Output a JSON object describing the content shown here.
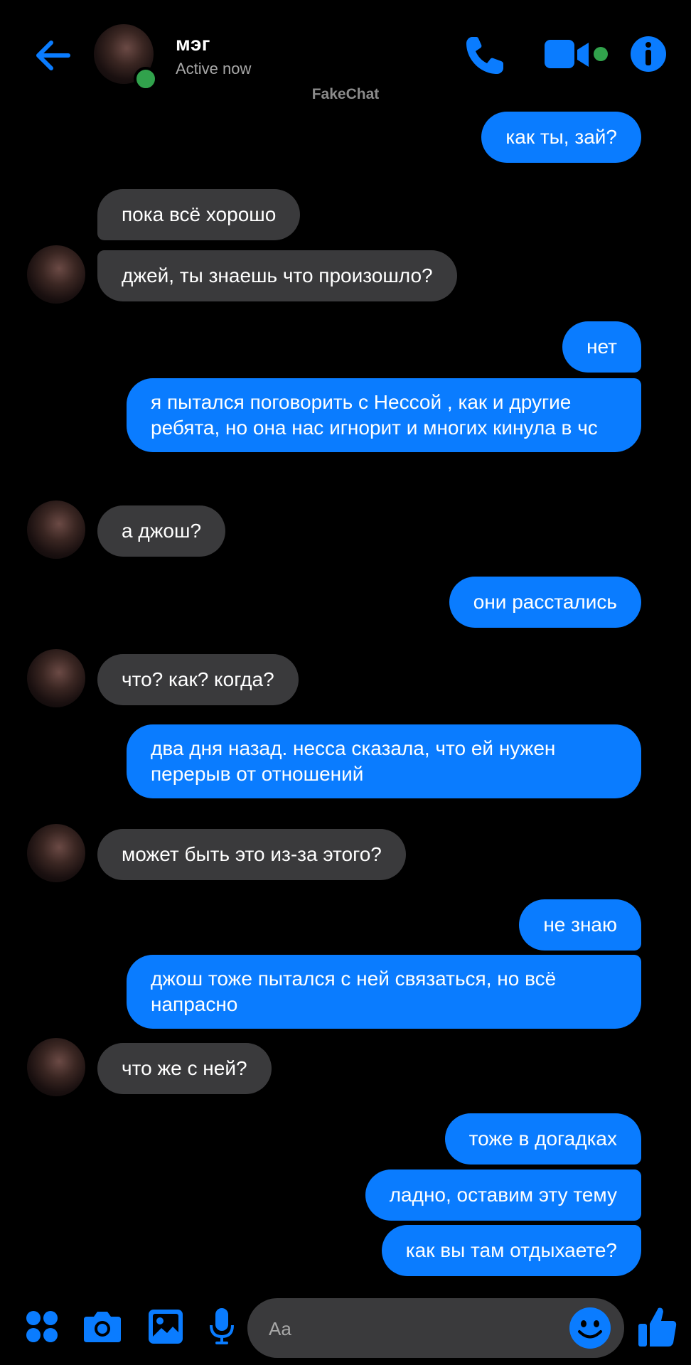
{
  "header": {
    "name": "мэг",
    "status": "Active now",
    "watermark": "FakeChat"
  },
  "colors": {
    "accent": "#0a7cff",
    "incoming_bubble": "#3a3a3c",
    "online": "#31a24c",
    "background": "#000000"
  },
  "icons": {
    "back": "arrow-left-icon",
    "call": "phone-icon",
    "video": "video-camera-icon",
    "info": "info-icon",
    "apps": "four-dots-icon",
    "camera": "camera-icon",
    "gallery": "image-icon",
    "mic": "microphone-icon",
    "emoji": "smiley-icon",
    "like": "thumbs-up-icon"
  },
  "messages": [
    {
      "dir": "out",
      "text": "как ты, зай?"
    },
    {
      "dir": "in",
      "text": "пока всё хорошо"
    },
    {
      "dir": "in",
      "text": "джей, ты знаешь что произошло?"
    },
    {
      "dir": "out",
      "text": "нет"
    },
    {
      "dir": "out",
      "text": "я пытался поговорить с Нессой , как и другие ребята, но она нас игнорит и многих кинула в чс"
    },
    {
      "dir": "in",
      "text": "а джош?"
    },
    {
      "dir": "out",
      "text": "они расстались"
    },
    {
      "dir": "in",
      "text": "что? как? когда?"
    },
    {
      "dir": "out",
      "text": "два дня назад.  несса сказала,  что ей нужен перерыв от отношений"
    },
    {
      "dir": "in",
      "text": "может быть это из-за этого?"
    },
    {
      "dir": "out",
      "text": "не знаю"
    },
    {
      "dir": "out",
      "text": "джош тоже пытался с ней связаться, но всё напрасно"
    },
    {
      "dir": "in",
      "text": "что же с ней?"
    },
    {
      "dir": "out",
      "text": "тоже в догадках"
    },
    {
      "dir": "out",
      "text": "ладно, оставим эту тему"
    },
    {
      "dir": "out",
      "text": "как вы там отдыхаете?"
    }
  ],
  "composer": {
    "placeholder": "Aa"
  }
}
